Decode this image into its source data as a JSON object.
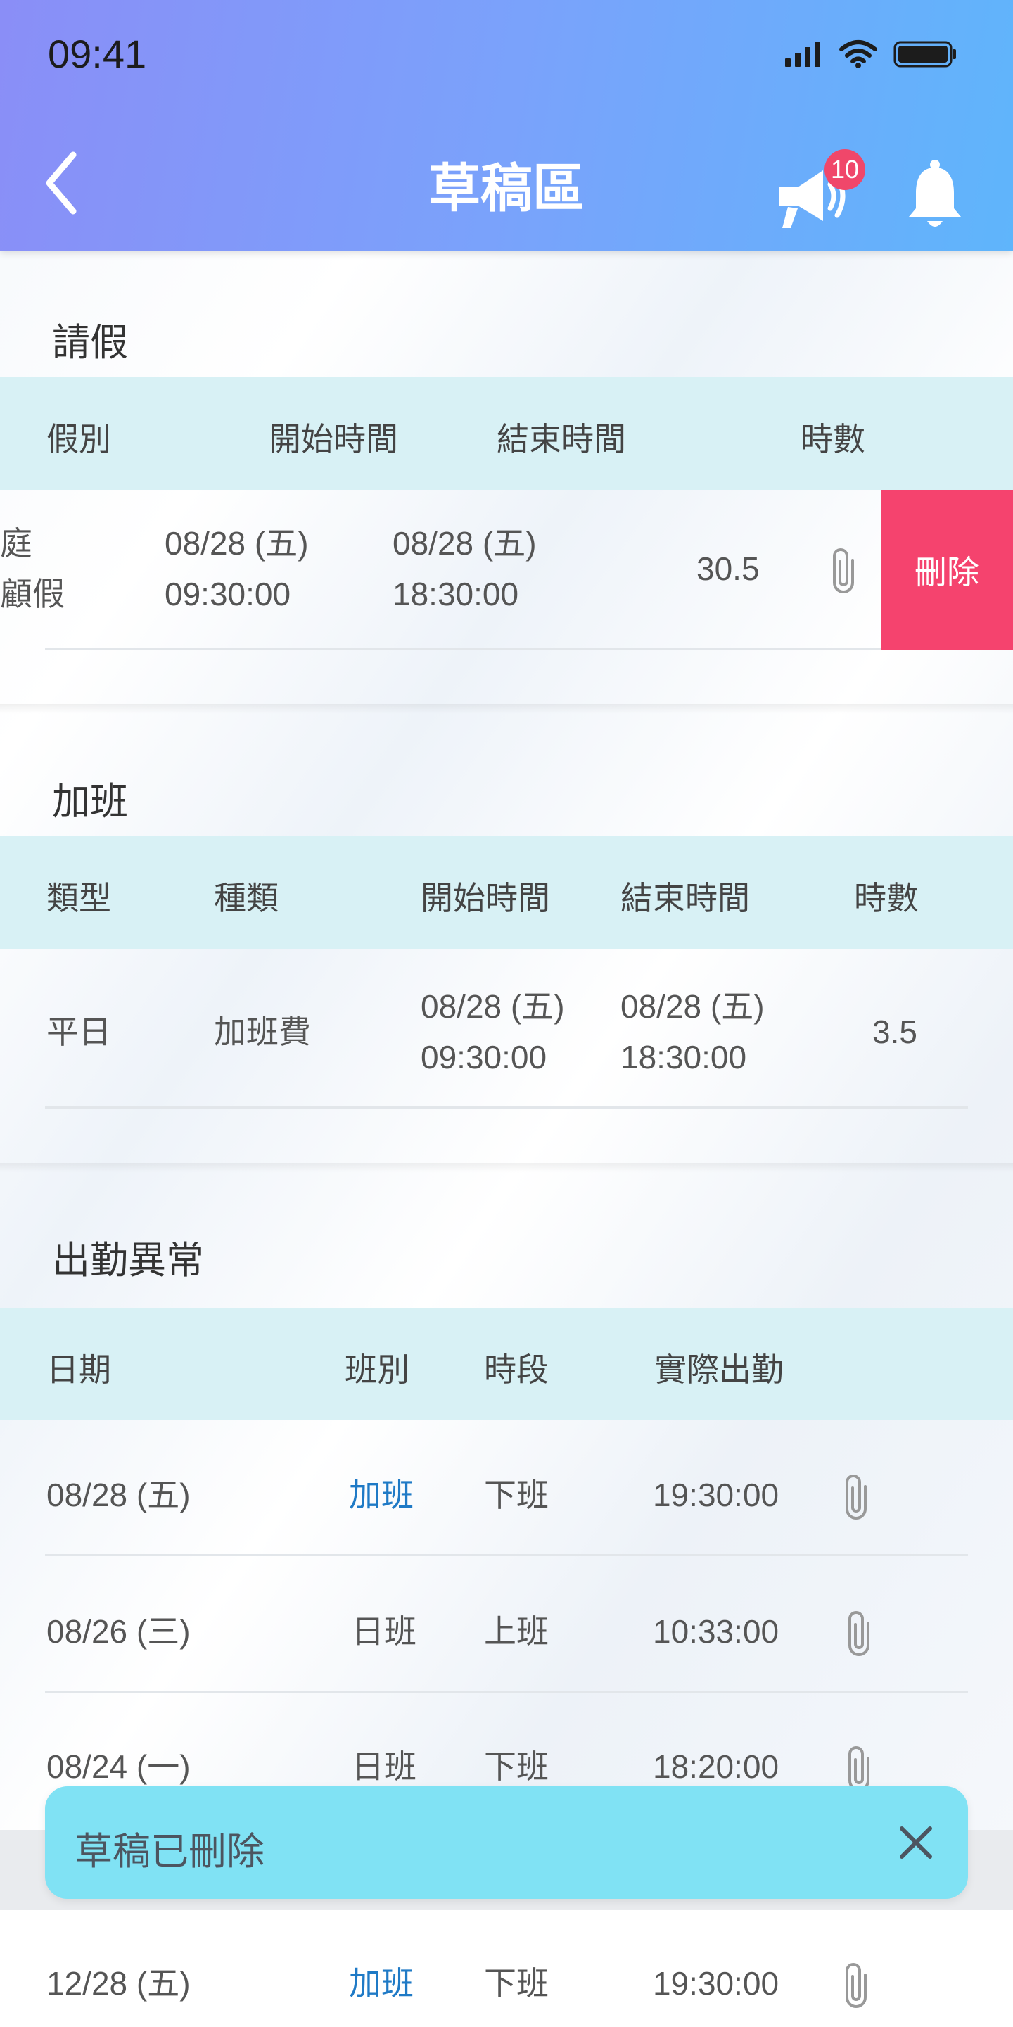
{
  "status_bar": {
    "time": "09:41",
    "icons": [
      "signal-icon",
      "wifi-icon",
      "battery-icon"
    ]
  },
  "nav": {
    "title": "草稿區",
    "badge_count": "10",
    "icons": [
      "back-arrow-icon",
      "megaphone-icon",
      "bell-icon"
    ]
  },
  "leave": {
    "title": "請假",
    "headers": [
      "假別",
      "開始時間",
      "結束時間",
      "時數"
    ],
    "row": {
      "type_line1": "庭",
      "type_line2": "顧假",
      "start_date": "08/28 (五)",
      "start_time": "09:30:00",
      "end_date": "08/28 (五)",
      "end_time": "18:30:00",
      "hours": "30.5"
    },
    "delete_label": "刪除"
  },
  "overtime": {
    "title": "加班",
    "headers": [
      "類型",
      "種類",
      "開始時間",
      "結束時間",
      "時數"
    ],
    "row": {
      "type": "平日",
      "kind": "加班費",
      "start_date": "08/28 (五)",
      "start_time": "09:30:00",
      "end_date": "08/28 (五)",
      "end_time": "18:30:00",
      "hours": "3.5"
    }
  },
  "attendance": {
    "title": "出勤異常",
    "headers": [
      "日期",
      "班別",
      "時段",
      "實際出勤"
    ],
    "rows": [
      {
        "date": "08/28 (五)",
        "shift": "加班",
        "period": "下班",
        "actual": "19:30:00"
      },
      {
        "date": "08/26 (三)",
        "shift": "日班",
        "period": "上班",
        "actual": "10:33:00"
      },
      {
        "date": "08/24 (一)",
        "shift": "日班",
        "period": "下班",
        "actual": "18:20:00"
      },
      {
        "date": "12/28 (五)",
        "shift": "加班",
        "period": "下班",
        "actual": "19:30:00"
      }
    ]
  },
  "toast": {
    "message": "草稿已刪除"
  },
  "colors": {
    "header_start": "#8a8ef7",
    "header_end": "#5fb5fb",
    "table_header": "#d8f1f5",
    "delete": "#f5436e",
    "link": "#1f7ac6",
    "toast": "#80e2f4",
    "badge": "#f0476a"
  }
}
